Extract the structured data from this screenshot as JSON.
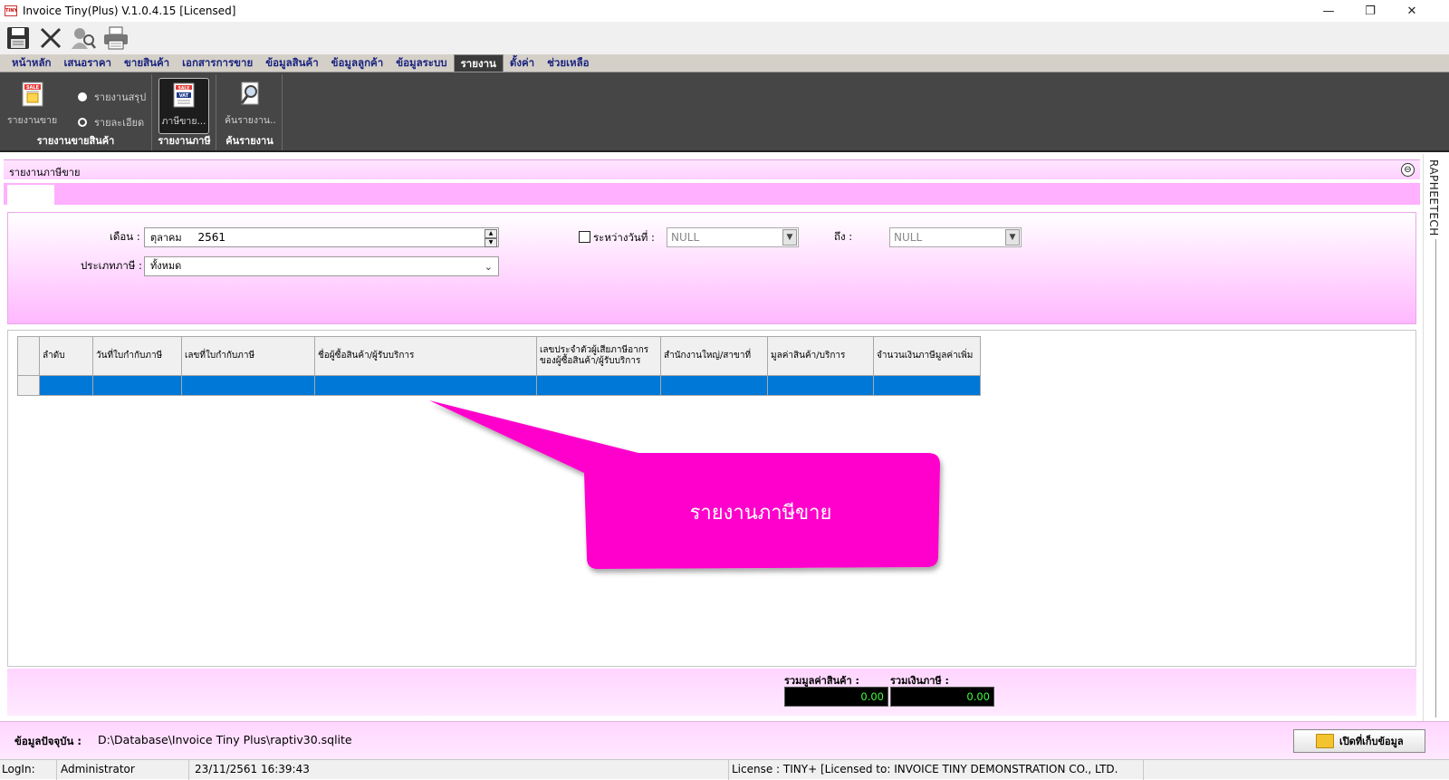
{
  "window": {
    "title": "Invoice Tiny(Plus)  V.1.0.4.15 [Licensed]",
    "app_icon_text": "TINY",
    "minimize": "—",
    "restore": "❐",
    "close": "✕"
  },
  "toolbar": {
    "icons": [
      "save-icon",
      "cut-icon",
      "search-user-icon",
      "printer-icon"
    ]
  },
  "menu": {
    "tabs": [
      {
        "label": "หน้าหลัก",
        "active": false
      },
      {
        "label": "เสนอราคา",
        "active": false
      },
      {
        "label": "ขายสินค้า",
        "active": false
      },
      {
        "label": "เอกสารการขาย",
        "active": false
      },
      {
        "label": "ข้อมูลสินค้า",
        "active": false
      },
      {
        "label": "ข้อมูลลูกค้า",
        "active": false
      },
      {
        "label": "ข้อมูลระบบ",
        "active": false
      },
      {
        "label": "รายงาน",
        "active": true
      },
      {
        "label": "ตั้งค่า",
        "active": false
      },
      {
        "label": "ช่วยเหลือ",
        "active": false
      }
    ]
  },
  "ribbon": {
    "sales_report": {
      "button_label": "รายงานขาย...",
      "radio_summary": "รายงานสรุป",
      "radio_detail": "รายละเอียด",
      "group_label": "รายงานขายสินค้า"
    },
    "tax_report": {
      "button_label": "ภาษีขาย...",
      "group_label": "รายงานภาษี"
    },
    "find_report": {
      "button_label": "ค้นรายงาน...",
      "group_label": "ค้นรายงาน"
    }
  },
  "side_panel": {
    "label": "RAPHEETECH"
  },
  "panel": {
    "title": "รายงานภาษีขาย",
    "collapse_icon": "⊖"
  },
  "filters": {
    "month_label": "เดือน :",
    "month_name": "ตุลาคม",
    "year": "2561",
    "tax_type_label": "ประเภทภาษี :",
    "tax_type_value": "ทั้งหมด",
    "between_label": "ระหว่างวันที่ :",
    "from_value": "NULL",
    "to_label": "ถึง :",
    "to_value": "NULL"
  },
  "grid": {
    "columns": [
      "ลำดับ",
      "วันที่ใบกำกับภาษี",
      "เลขที่ใบกำกับภาษี",
      "ชื่อผู้ซื้อสินค้า/ผู้รับบริการ",
      "เลขประจำตัวผู้เสียภาษีอากร\nของผู้ซื้อสินค้า/ผู้รับบริการ",
      "สำนักงานใหญ่/สาขาที่",
      "มูลค่าสินค้า/บริการ",
      "จำนวนเงินภาษีมูลค่าเพิ่ม"
    ]
  },
  "callout": {
    "text": "รายงานภาษีขาย",
    "color": "#ff00cc"
  },
  "totals": {
    "product_value_label": "รวมมูลค่าสินค้า :",
    "product_value": "0.00",
    "tax_label": "รวมเงินภาษี :",
    "tax_value": "0.00"
  },
  "path": {
    "label": "ข้อมูลปัจจุบัน :",
    "value": "D:\\Database\\Invoice Tiny Plus\\raptiv30.sqlite",
    "open_button": "เปิดที่เก็บข้อมูล"
  },
  "status": {
    "login_label": "LogIn:",
    "user": "Administrator",
    "datetime": "23/11/2561 16:39:43",
    "license": "License : TINY+ [Licensed to: INVOICE TINY DEMONSTRATION CO., LTD."
  }
}
